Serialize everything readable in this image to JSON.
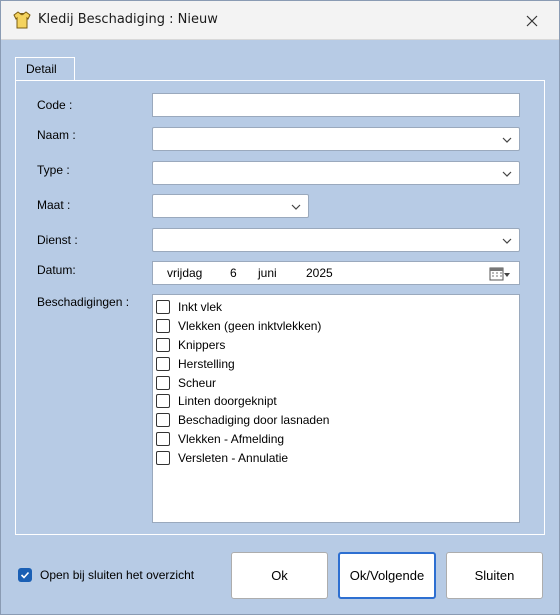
{
  "window": {
    "title": "Kledij Beschadiging : Nieuw",
    "icon": "shirt-icon",
    "close_icon": "close-icon"
  },
  "tabs": [
    {
      "label": "Detail",
      "active": true
    }
  ],
  "form": {
    "code": {
      "label": "Code :",
      "value": ""
    },
    "naam": {
      "label": "Naam :",
      "value": ""
    },
    "type": {
      "label": "Type :",
      "value": ""
    },
    "maat": {
      "label": "Maat :",
      "value": ""
    },
    "dienst": {
      "label": "Dienst :",
      "value": ""
    },
    "datum": {
      "label": "Datum:",
      "weekday": "vrijdag",
      "day": "6",
      "month": "juni",
      "year": "2025"
    },
    "beschadigingen": {
      "label": "Beschadigingen :",
      "items": [
        {
          "label": "Inkt vlek",
          "checked": false
        },
        {
          "label": "Vlekken (geen inktvlekken)",
          "checked": false
        },
        {
          "label": "Knippers",
          "checked": false
        },
        {
          "label": "Herstelling",
          "checked": false
        },
        {
          "label": "Scheur",
          "checked": false
        },
        {
          "label": "Linten doorgeknipt",
          "checked": false
        },
        {
          "label": "Beschadiging door lasnaden",
          "checked": false
        },
        {
          "label": "Vlekken - Afmelding",
          "checked": false
        },
        {
          "label": "Versleten - Annulatie",
          "checked": false
        }
      ]
    }
  },
  "footer": {
    "open_overview": {
      "label": "Open bij sluiten het overzicht",
      "checked": true
    },
    "ok_label": "Ok",
    "ok_next_label": "Ok/Volgende",
    "close_label": "Sluiten"
  },
  "colors": {
    "background": "#b7cbe5",
    "accent": "#1a5fb4",
    "focus_border": "#2d6fd1"
  }
}
